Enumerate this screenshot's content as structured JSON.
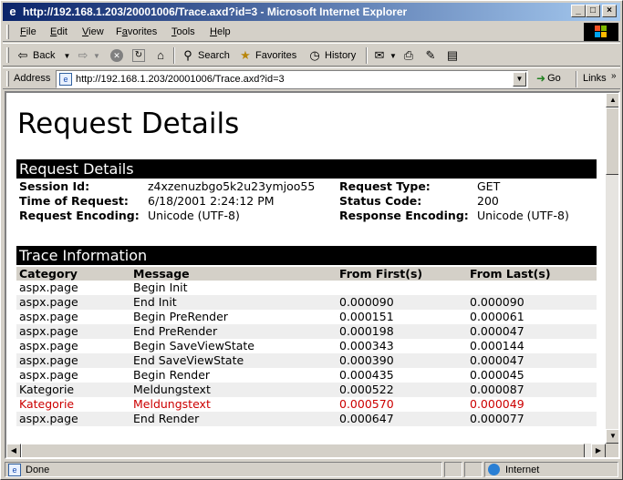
{
  "window": {
    "title": "http://192.168.1.203/20001006/Trace.axd?id=3 - Microsoft Internet Explorer",
    "minimize": "_",
    "maximize": "□",
    "close": "×"
  },
  "menu": {
    "items": [
      {
        "label": "File",
        "mnemonic": "F",
        "rest": "ile"
      },
      {
        "label": "Edit",
        "mnemonic": "E",
        "rest": "dit"
      },
      {
        "label": "View",
        "mnemonic": "V",
        "rest": "iew"
      },
      {
        "label": "Favorites",
        "mnemonic": "a",
        "pre": "F",
        "rest": "vorites"
      },
      {
        "label": "Tools",
        "mnemonic": "T",
        "rest": "ools"
      },
      {
        "label": "Help",
        "mnemonic": "H",
        "rest": "elp"
      }
    ]
  },
  "toolbar": {
    "back_label": "Back",
    "search_label": "Search",
    "favorites_label": "Favorites",
    "history_label": "History"
  },
  "address": {
    "label": "Address",
    "url": "http://192.168.1.203/20001006/Trace.axd?id=3",
    "go_label": "Go",
    "links_label": "Links"
  },
  "page": {
    "title": "Request Details",
    "request_section": {
      "header": "Request Details",
      "session_id_key": "Session Id:",
      "session_id_value": "z4xzenuzbgo5k2u23ymjoo55",
      "request_type_key": "Request Type:",
      "request_type_value": "GET",
      "time_key": "Time of Request:",
      "time_value": "6/18/2001 2:24:12 PM",
      "status_code_key": "Status Code:",
      "status_code_value": "200",
      "req_encoding_key": "Request Encoding:",
      "req_encoding_value": "Unicode (UTF-8)",
      "resp_encoding_key": "Response Encoding:",
      "resp_encoding_value": "Unicode (UTF-8)"
    },
    "trace_section": {
      "header": "Trace Information",
      "columns": [
        "Category",
        "Message",
        "From First(s)",
        "From Last(s)"
      ],
      "rows": [
        {
          "category": "aspx.page",
          "message": "Begin Init",
          "from_first": "",
          "from_last": "",
          "warn": false
        },
        {
          "category": "aspx.page",
          "message": "End Init",
          "from_first": "0.000090",
          "from_last": "0.000090",
          "warn": false
        },
        {
          "category": "aspx.page",
          "message": "Begin PreRender",
          "from_first": "0.000151",
          "from_last": "0.000061",
          "warn": false
        },
        {
          "category": "aspx.page",
          "message": "End PreRender",
          "from_first": "0.000198",
          "from_last": "0.000047",
          "warn": false
        },
        {
          "category": "aspx.page",
          "message": "Begin SaveViewState",
          "from_first": "0.000343",
          "from_last": "0.000144",
          "warn": false
        },
        {
          "category": "aspx.page",
          "message": "End SaveViewState",
          "from_first": "0.000390",
          "from_last": "0.000047",
          "warn": false
        },
        {
          "category": "aspx.page",
          "message": "Begin Render",
          "from_first": "0.000435",
          "from_last": "0.000045",
          "warn": false
        },
        {
          "category": "Kategorie",
          "message": "Meldungstext",
          "from_first": "0.000522",
          "from_last": "0.000087",
          "warn": false
        },
        {
          "category": "Kategorie",
          "message": "Meldungstext",
          "from_first": "0.000570",
          "from_last": "0.000049",
          "warn": true
        },
        {
          "category": "aspx.page",
          "message": "End Render",
          "from_first": "0.000647",
          "from_last": "0.000077",
          "warn": false
        }
      ]
    }
  },
  "status": {
    "text": "Done",
    "zone": "Internet"
  },
  "colors": {
    "titlebar_start": "#0a246a",
    "titlebar_end": "#a6caf0",
    "section_header": "#000000",
    "warn_text": "#cc0000",
    "chrome": "#d4d0c8"
  }
}
